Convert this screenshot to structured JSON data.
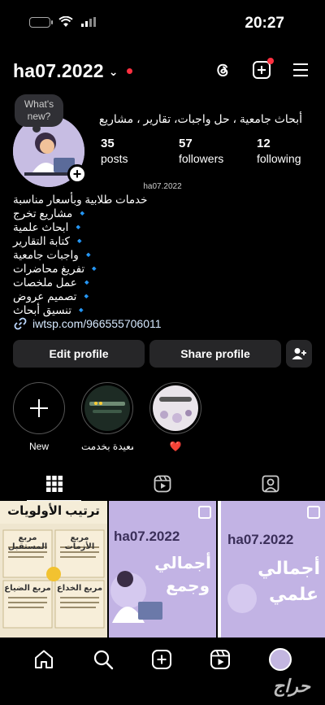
{
  "status": {
    "time": "20:27"
  },
  "header": {
    "username": "ha07.2022"
  },
  "note": {
    "text": "What's new?"
  },
  "profile": {
    "category": "أبحاث جامعية ، حل واجبات، تقارير ، مشاريع",
    "stats": [
      {
        "num": "35",
        "label": "posts"
      },
      {
        "num": "57",
        "label": "followers"
      },
      {
        "num": "12",
        "label": "following"
      }
    ],
    "threads_badge": "ha07.2022",
    "bio": [
      "خدمات طلابية وبأسعار مناسبة",
      "🔹 مشاريع تخرج",
      "🔹 ابحاث علمية",
      "🔹 كتابة التقارير",
      "🔹 واجبات جامعية",
      "🔹 تفريغ محاضرات",
      "🔹 عمل ملخصات",
      "🔹 تصميم عروض",
      "🔹 تنسيق أبحاث"
    ],
    "link": "iwtsp.com/966555706011"
  },
  "actions": {
    "edit": "Edit profile",
    "share": "Share profile"
  },
  "highlights": [
    {
      "label": "New"
    },
    {
      "label": "سعيدة بخدمت..."
    },
    {
      "label": "❤️"
    }
  ],
  "posts": [
    {
      "title": "ترتيب الأولويات",
      "sub": [
        "مربع المستقبل",
        "مربع الأزمات",
        "مربع الضياع",
        "مربع الخداع"
      ]
    },
    {
      "title": "ha07.2022",
      "sub": [
        "أجمالي",
        "وجمع"
      ]
    },
    {
      "title": "ha07.2022",
      "sub": [
        "أجمالي",
        "علمي"
      ]
    }
  ],
  "watermark": "حراج",
  "colors": {
    "background": "#000000",
    "button": "#262628",
    "accent_red": "#ff3040",
    "avatar_purple": "#c3b6e0"
  }
}
